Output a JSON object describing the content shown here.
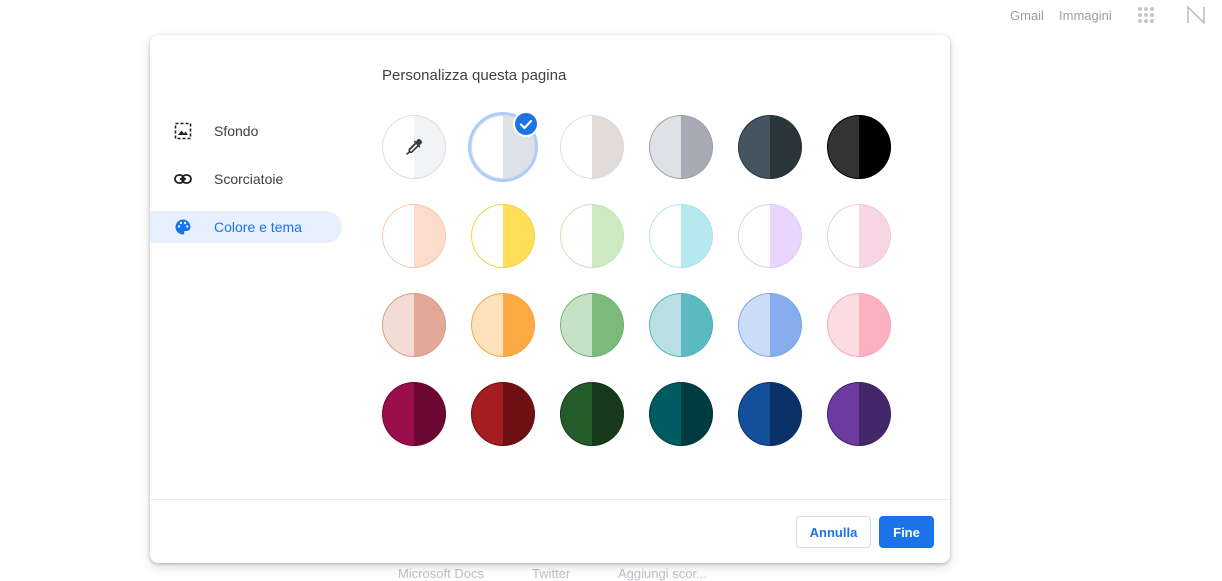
{
  "topbar": {
    "gmail": "Gmail",
    "images": "Immagini"
  },
  "bottom_links": [
    "Microsoft Docs",
    "Twitter",
    "Aggiungi scor..."
  ],
  "dialog": {
    "sidebar": [
      {
        "label": "Sfondo",
        "icon": "image-icon",
        "active": false
      },
      {
        "label": "Scorciatoie",
        "icon": "link-icon",
        "active": false
      },
      {
        "label": "Colore e tema",
        "icon": "palette-icon",
        "active": true
      }
    ],
    "title": "Personalizza questa pagina",
    "cancel_label": "Annulla",
    "done_label": "Fine",
    "colors": {
      "accent": "#1a73e8",
      "selected_ring": "#aecbfa"
    },
    "swatches": [
      [
        {
          "left": "#ffffff",
          "right": "#f1f3f4",
          "border": "#dadce0",
          "custom": true,
          "selected": false
        },
        {
          "left": "#ffffff",
          "right": "#dee1e6",
          "border": "#dadce0",
          "custom": false,
          "selected": true
        },
        {
          "left": "#ffffff",
          "right": "#e3dbd7",
          "border": "#dadce0",
          "custom": false,
          "selected": false
        },
        {
          "left": "#dee1e6",
          "right": "#a8abb6",
          "border": "#9aa0a6",
          "custom": false,
          "selected": false
        },
        {
          "left": "#455560",
          "right": "#2a343b",
          "border": "#2a343b",
          "custom": false,
          "selected": false
        },
        {
          "left": "#333333",
          "right": "#000000",
          "border": "#000000",
          "custom": false,
          "selected": false
        }
      ],
      [
        {
          "left": "#ffffff",
          "right": "#fddccb",
          "border": "#f7c7ad",
          "custom": false,
          "selected": false
        },
        {
          "left": "#ffffff",
          "right": "#ffde5a",
          "border": "#f6ce35",
          "custom": false,
          "selected": false
        },
        {
          "left": "#ffffff",
          "right": "#cde9c2",
          "border": "#c3e2b6",
          "custom": false,
          "selected": false
        },
        {
          "left": "#ffffff",
          "right": "#b6e8f2",
          "border": "#a9e2ee",
          "custom": false,
          "selected": false
        },
        {
          "left": "#ffffff",
          "right": "#e9d5fd",
          "border": "#dfc6f8",
          "custom": false,
          "selected": false
        },
        {
          "left": "#ffffff",
          "right": "#f7d6e4",
          "border": "#f0c8d9",
          "custom": false,
          "selected": false
        }
      ],
      [
        {
          "left": "#f2ddd6",
          "right": "#e2a898",
          "border": "#d9988a",
          "custom": false,
          "selected": false
        },
        {
          "left": "#fde2bb",
          "right": "#fcab44",
          "border": "#f6a53b",
          "custom": false,
          "selected": false
        },
        {
          "left": "#c5e2c6",
          "right": "#7abb7b",
          "border": "#70b272",
          "custom": false,
          "selected": false
        },
        {
          "left": "#b8e0e3",
          "right": "#5bbac1",
          "border": "#52b1b8",
          "custom": false,
          "selected": false
        },
        {
          "left": "#cbdcf7",
          "right": "#86aded",
          "border": "#7aa4e8",
          "custom": false,
          "selected": false
        },
        {
          "left": "#fcdde3",
          "right": "#fdb0be",
          "border": "#f8a6b5",
          "custom": false,
          "selected": false
        }
      ],
      [
        {
          "left": "#9a0f4b",
          "right": "#6a0833",
          "border": "#6a0833",
          "custom": false,
          "selected": false
        },
        {
          "left": "#a51c21",
          "right": "#6e1012",
          "border": "#6e1012",
          "custom": false,
          "selected": false
        },
        {
          "left": "#245b2a",
          "right": "#17381b",
          "border": "#17381b",
          "custom": false,
          "selected": false
        },
        {
          "left": "#005c62",
          "right": "#003b41",
          "border": "#003b41",
          "custom": false,
          "selected": false
        },
        {
          "left": "#134f9b",
          "right": "#0b3268",
          "border": "#0b3268",
          "custom": false,
          "selected": false
        },
        {
          "left": "#6d3aa0",
          "right": "#43276a",
          "border": "#43276a",
          "custom": false,
          "selected": false
        }
      ]
    ]
  }
}
